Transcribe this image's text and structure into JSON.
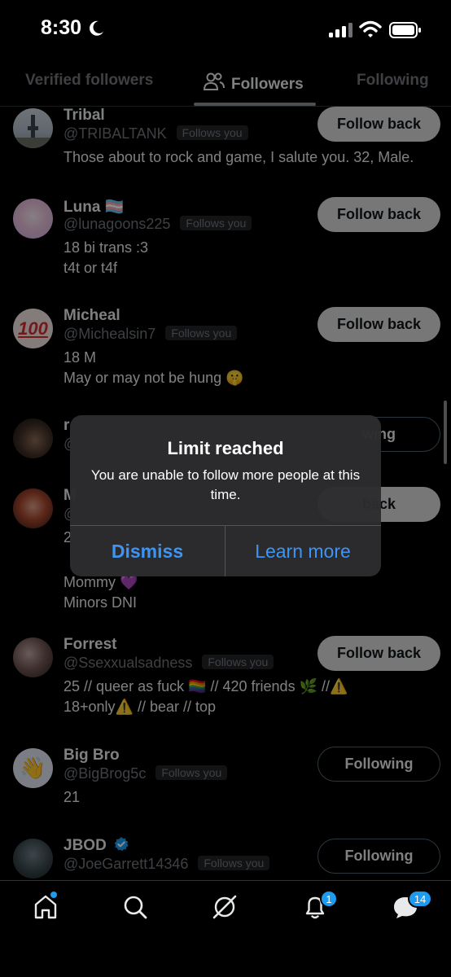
{
  "status_bar": {
    "time": "8:30"
  },
  "tabs": [
    {
      "label": "Verified followers",
      "active": false
    },
    {
      "label": "Followers",
      "active": true
    },
    {
      "label": "Following",
      "active": false
    }
  ],
  "followers": [
    {
      "name": "Tribal",
      "handle": "@TRIBALTANK",
      "follows_you": "Follows you",
      "bio": [
        "Those about to rock and game, I salute you. 32, Male."
      ],
      "button": "Follow back"
    },
    {
      "name": "Luna 🏳️‍⚧️",
      "handle": "@lunagoons225",
      "follows_you": "Follows you",
      "bio": [
        "18 bi trans :3",
        "t4t or t4f"
      ],
      "button": "Follow back"
    },
    {
      "name": "Micheal",
      "handle": "@Michealsin7",
      "follows_you": "Follows you",
      "bio": [
        "18 M",
        "May or may not be hung 🤫"
      ],
      "button": "Follow back"
    },
    {
      "name": "r",
      "handle": "@",
      "follows_you": "",
      "bio": [],
      "button": "wing"
    },
    {
      "name": "M",
      "handle": "@",
      "follows_you": "",
      "bio": [
        "2",
        "Mommy 💜",
        "Minors DNI"
      ],
      "button": "back"
    },
    {
      "name": "Forrest",
      "handle": "@Ssexxualsadness",
      "follows_you": "Follows you",
      "bio": [
        "25 // queer as fuck 🏳️‍🌈 // 420 friends 🌿 //⚠️",
        "18+only⚠️ // bear // top"
      ],
      "button": "Follow back"
    },
    {
      "name": "Big Bro",
      "handle": "@BigBrog5c",
      "follows_you": "Follows you",
      "bio": [
        "21"
      ],
      "button": "Following"
    },
    {
      "name": "JBOD",
      "handle": "@JoeGarrett14346",
      "follows_you": "Follows you",
      "bio": [],
      "button": "Following"
    }
  ],
  "alert": {
    "title": "Limit reached",
    "message": "You are unable to follow more people at this time.",
    "dismiss": "Dismiss",
    "learn_more": "Learn more"
  },
  "tab_bar": {
    "icons": [
      "home-icon",
      "search-icon",
      "grok-icon",
      "notifications-icon",
      "messages-icon"
    ],
    "notifications_count": "1",
    "messages_count": "14"
  },
  "colors": {
    "accent": "#1d9bf0",
    "link": "#3c95f5",
    "background": "#000000",
    "verified": "#1d9bf0"
  }
}
